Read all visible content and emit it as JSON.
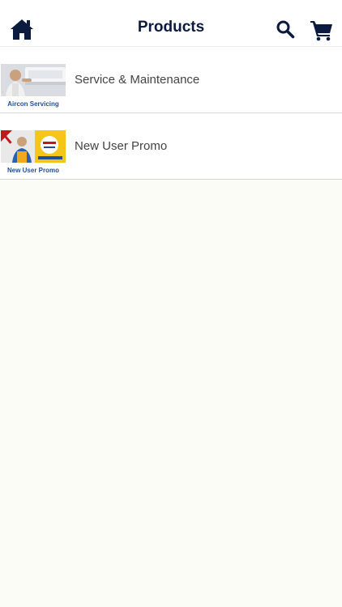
{
  "header": {
    "title": "Products",
    "home_icon": "home-icon",
    "search_icon": "search-icon",
    "cart_icon": "cart-icon",
    "icon_color": "#0b1a3f"
  },
  "products": [
    {
      "label": "Service & Maintenance",
      "thumb_caption": "Aircon Servicing",
      "thumb": "aircon-servicing-image"
    },
    {
      "label": "New User Promo",
      "thumb_caption": "New User Promo",
      "thumb": "new-user-promo-image"
    }
  ],
  "colors": {
    "background": "#fcfcf6",
    "caption": "#1f4f97",
    "label": "#444444"
  }
}
